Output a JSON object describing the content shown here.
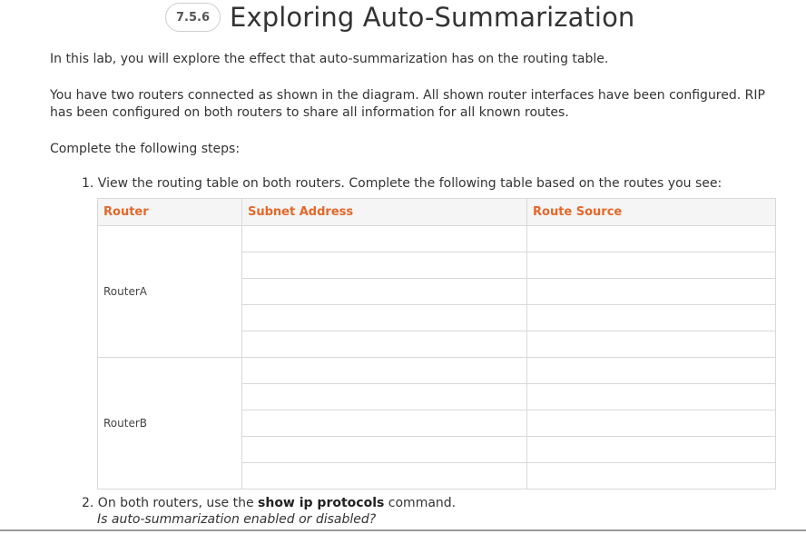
{
  "header": {
    "badge": "7.5.6",
    "title": "Exploring Auto-Summarization"
  },
  "intro": {
    "p1": "In this lab, you will explore the effect that auto-summarization has on the routing table.",
    "p2": "You have two routers connected as shown in the diagram. All shown router interfaces have been configured. RIP has been configured on both routers to share all information for all known routes.",
    "p3": "Complete the following steps:"
  },
  "steps": {
    "step1": "1. View the routing table on both routers. Complete the following table based on the routes you see:",
    "step2_prefix": "2. On both routers, use the ",
    "step2_command": "show ip protocols",
    "step2_suffix": " command.",
    "step2_question": "Is auto-summarization enabled or disabled?"
  },
  "table": {
    "headers": [
      "Router",
      "Subnet Address",
      "Route Source"
    ],
    "routers": [
      "RouterA",
      "RouterB"
    ]
  },
  "colors": {
    "header_text": "#e4682a",
    "header_bg": "#f5f5f5",
    "border": "#d8d8d8"
  }
}
